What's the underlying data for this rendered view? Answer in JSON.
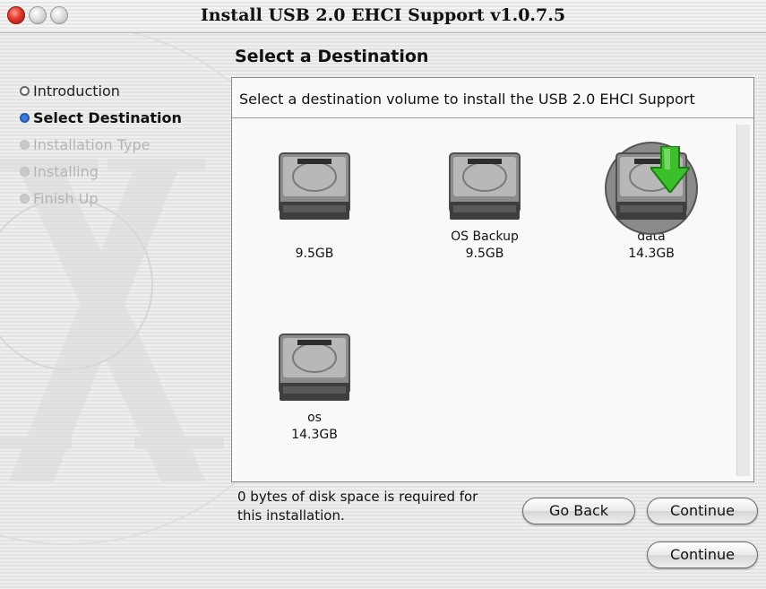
{
  "window": {
    "title": "Install USB 2.0 EHCI Support v1.0.7.5"
  },
  "sidebar": {
    "steps": [
      {
        "label": "Introduction",
        "state": "done"
      },
      {
        "label": "Select Destination",
        "state": "current"
      },
      {
        "label": "Installation Type",
        "state": "future"
      },
      {
        "label": "Installing",
        "state": "future"
      },
      {
        "label": "Finish Up",
        "state": "future"
      }
    ]
  },
  "main": {
    "heading": "Select a Destination",
    "message": "Select a destination volume to install the USB 2.0 EHCI Support",
    "volumes": [
      {
        "name": "",
        "size": "9.5GB",
        "icon": "hard-drive-icon",
        "selected": false
      },
      {
        "name": "OS Backup",
        "size": "9.5GB",
        "icon": "hard-drive-icon",
        "selected": false
      },
      {
        "name": "data",
        "size": "14.3GB",
        "icon": "hard-drive-icon",
        "selected": true
      },
      {
        "name": "os",
        "size": "14.3GB",
        "icon": "hard-drive-icon",
        "selected": false
      }
    ]
  },
  "footer": {
    "info": "0 bytes of disk space is required for this installation.",
    "go_back": "Go Back",
    "continue": "Continue",
    "continue2": "Continue"
  },
  "colors": {
    "selected_bullet": "#3a7be0",
    "install_arrow": "#3bbf2a"
  }
}
